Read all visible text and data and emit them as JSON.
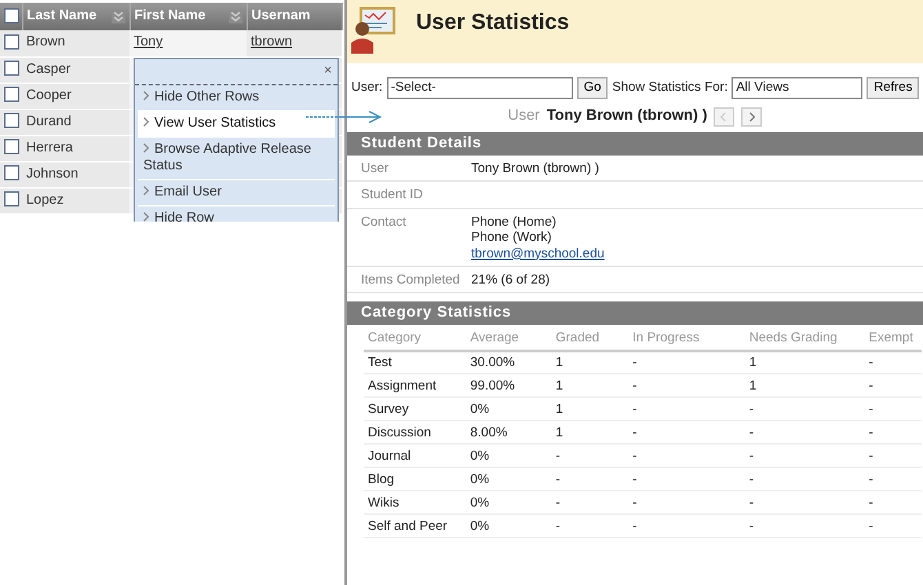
{
  "grid": {
    "select_all_checked": false,
    "columns": [
      {
        "label": "Last Name",
        "sort_icon": true
      },
      {
        "label": "First Name",
        "sort_icon": true
      },
      {
        "label": "Usernam",
        "sort_icon": false
      }
    ],
    "rows": [
      {
        "checked": false,
        "cells": [
          "Brown",
          "Tony",
          "tbrown"
        ]
      },
      {
        "checked": false,
        "cells": [
          "Casper"
        ]
      },
      {
        "checked": false,
        "cells": [
          "Cooper"
        ]
      },
      {
        "checked": false,
        "cells": [
          "Durand"
        ]
      },
      {
        "checked": false,
        "cells": [
          "Herrera"
        ]
      },
      {
        "checked": false,
        "cells": [
          "Johnson"
        ]
      },
      {
        "checked": false,
        "cells": [
          "Lopez"
        ]
      }
    ]
  },
  "context_menu": {
    "close": "×",
    "items": [
      {
        "label": "Hide Other Rows",
        "selected": false
      },
      {
        "label": "View User Statistics",
        "selected": true
      },
      {
        "label": "Browse Adaptive Release Status",
        "selected": false
      },
      {
        "label": "Email User",
        "selected": false
      },
      {
        "label": "Hide Row",
        "selected": false
      }
    ]
  },
  "page": {
    "title": "User Statistics",
    "toolbar": {
      "user_label": "User:",
      "user_value": "-Select-",
      "go": "Go",
      "show_label": "Show Statistics For:",
      "show_value": "All Views",
      "refresh": "Refres"
    },
    "user_nav": {
      "label": "User",
      "name": "Tony Brown (tbrown) )",
      "pager": [
        {
          "kind": "prev",
          "disabled": true
        },
        {
          "kind": "next",
          "disabled": false
        }
      ]
    },
    "student_details": {
      "title": "Student Details",
      "rows": [
        {
          "label": "User",
          "values": [
            "Tony Brown (tbrown) )"
          ]
        },
        {
          "label": "Student ID",
          "values": []
        },
        {
          "label": "Contact",
          "values": [
            "Phone (Home)",
            "Phone (Work)"
          ],
          "link": "tbrown@myschool.edu"
        },
        {
          "label": "Items Completed",
          "values": [
            "21% (6 of 28)"
          ]
        }
      ]
    },
    "category_statistics": {
      "title": "Category Statistics",
      "columns": [
        "Category",
        "Average",
        "Graded",
        "In Progress",
        "Needs Grading",
        "Exempt"
      ],
      "rows": [
        [
          "Test",
          "30.00%",
          "1",
          "-",
          "1",
          "-"
        ],
        [
          "Assignment",
          "99.00%",
          "1",
          "-",
          "1",
          "-"
        ],
        [
          "Survey",
          "0%",
          "1",
          "-",
          "-",
          "-"
        ],
        [
          "Discussion",
          "8.00%",
          "1",
          "-",
          "-",
          "-"
        ],
        [
          "Journal",
          "0%",
          "-",
          "-",
          "-",
          "-"
        ],
        [
          "Blog",
          "0%",
          "-",
          "-",
          "-",
          "-"
        ],
        [
          "Wikis",
          "0%",
          "-",
          "-",
          "-",
          "-"
        ],
        [
          "Self and Peer",
          "0%",
          "-",
          "-",
          "-",
          "-"
        ]
      ]
    }
  }
}
